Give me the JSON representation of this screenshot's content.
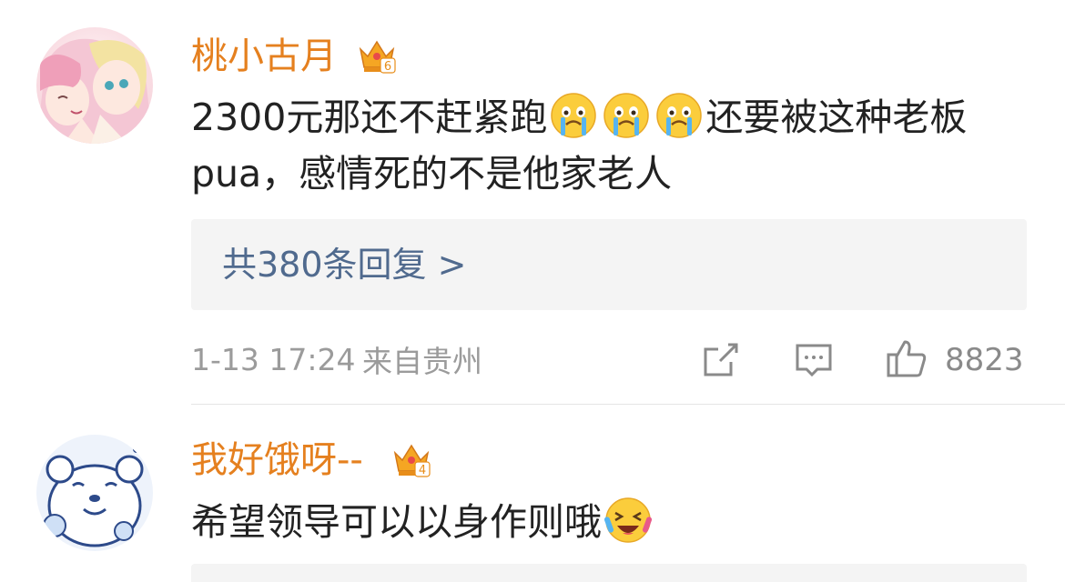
{
  "comments": [
    {
      "username": "桃小古月",
      "level": "6",
      "text_part1": "2300元那还不赶紧跑",
      "text_part2": "还要被这种老板pua，感情死的不是他家老人",
      "reply_summary": "共380条回复 >",
      "timestamp": "1-13 17:24",
      "location": "来自贵州",
      "like_count": "8823"
    },
    {
      "username": "我好饿呀--",
      "level": "4",
      "text_part1": "希望领导可以以身作则哦",
      "text_part2": ""
    }
  ],
  "icons": {
    "crown": "crown-badge-icon",
    "crying": "crying-face-icon",
    "laughing_crying": "laughing-crying-face-icon",
    "share": "share-icon",
    "reply": "comment-icon",
    "like": "thumbs-up-icon"
  },
  "colors": {
    "username": "#e5801f",
    "reply_link": "#506a8e",
    "meta": "#9b9b9b"
  }
}
